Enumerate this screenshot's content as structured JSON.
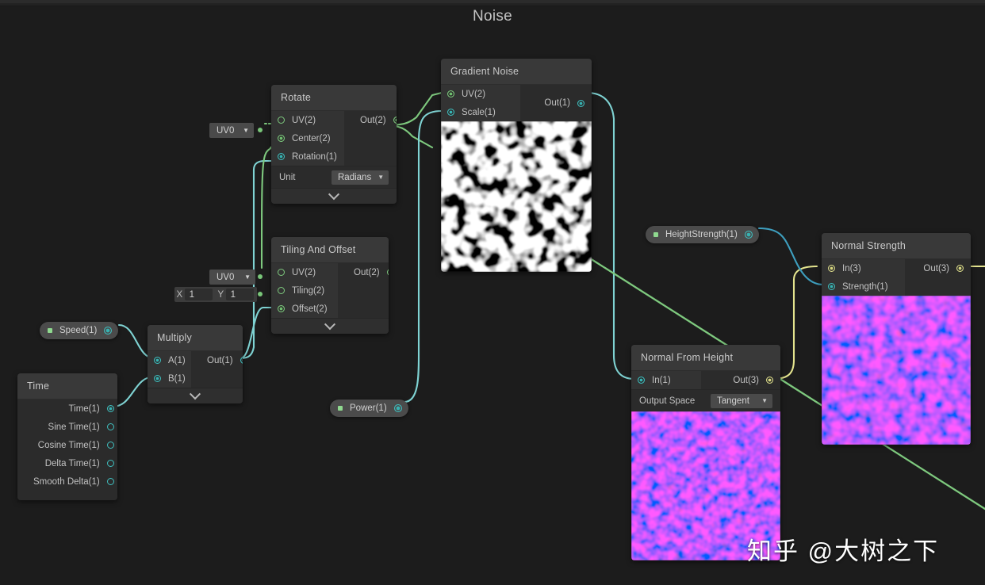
{
  "window": {
    "graph_title": "Noise"
  },
  "watermark": {
    "text": "知乎 @大树之下"
  },
  "nodes": {
    "rotate": {
      "title": "Rotate",
      "inputs": [
        {
          "label": "UV(2)",
          "type": "green",
          "connected": false
        },
        {
          "label": "Center(2)",
          "type": "green",
          "connected": true
        },
        {
          "label": "Rotation(1)",
          "type": "cyan",
          "connected": true
        }
      ],
      "outputs": [
        {
          "label": "Out(2)",
          "type": "green",
          "connected": true
        }
      ],
      "control": {
        "label": "Unit",
        "value": "Radians"
      }
    },
    "gradient_noise": {
      "title": "Gradient Noise",
      "inputs": [
        {
          "label": "UV(2)",
          "type": "green",
          "connected": true
        },
        {
          "label": "Scale(1)",
          "type": "cyan",
          "connected": true
        }
      ],
      "outputs": [
        {
          "label": "Out(1)",
          "type": "cyan",
          "connected": true
        }
      ],
      "preview": "grayscale-noise"
    },
    "tiling_and_offset": {
      "title": "Tiling And Offset",
      "inputs": [
        {
          "label": "UV(2)",
          "type": "green",
          "connected": false
        },
        {
          "label": "Tiling(2)",
          "type": "green",
          "connected": false
        },
        {
          "label": "Offset(2)",
          "type": "green",
          "connected": true
        }
      ],
      "outputs": [
        {
          "label": "Out(2)",
          "type": "green",
          "connected": false
        }
      ]
    },
    "multiply": {
      "title": "Multiply",
      "inputs": [
        {
          "label": "A(1)",
          "type": "cyan",
          "connected": true
        },
        {
          "label": "B(1)",
          "type": "cyan",
          "connected": true
        }
      ],
      "outputs": [
        {
          "label": "Out(1)",
          "type": "cyan",
          "connected": true
        }
      ]
    },
    "time": {
      "title": "Time",
      "outputs": [
        {
          "label": "Time(1)",
          "type": "cyan",
          "connected": true
        },
        {
          "label": "Sine Time(1)",
          "type": "cyan",
          "connected": false
        },
        {
          "label": "Cosine Time(1)",
          "type": "cyan",
          "connected": false
        },
        {
          "label": "Delta Time(1)",
          "type": "cyan",
          "connected": false
        },
        {
          "label": "Smooth Delta(1)",
          "type": "cyan",
          "connected": false
        }
      ]
    },
    "normal_from_height": {
      "title": "Normal From Height",
      "inputs": [
        {
          "label": "In(1)",
          "type": "cyan",
          "connected": true
        }
      ],
      "outputs": [
        {
          "label": "Out(3)",
          "type": "yellow",
          "connected": true
        }
      ],
      "control": {
        "label": "Output Space",
        "value": "Tangent"
      },
      "preview": "normal-map"
    },
    "normal_strength": {
      "title": "Normal Strength",
      "inputs": [
        {
          "label": "In(3)",
          "type": "yellow",
          "connected": true
        },
        {
          "label": "Strength(1)",
          "type": "cyan",
          "connected": true
        }
      ],
      "outputs": [
        {
          "label": "Out(3)",
          "type": "yellow",
          "connected": true
        }
      ],
      "preview": "normal-map"
    }
  },
  "properties": [
    {
      "name": "speed",
      "label": "Speed(1)",
      "type": "cyan"
    },
    {
      "name": "power",
      "label": "Power(1)",
      "type": "cyan"
    },
    {
      "name": "height_strength",
      "label": "HeightStrength(1)",
      "type": "cyan"
    }
  ],
  "widgets": {
    "uv_rotate": {
      "value": "UV0"
    },
    "uv_tiling": {
      "value": "UV0"
    },
    "tiling_vector": {
      "x_label": "X",
      "x_value": "1",
      "y_label": "Y",
      "y_value": "1"
    }
  },
  "colors": {
    "background": "#1c1c1c",
    "node_body": "#2b2b2b",
    "node_header": "#393939",
    "edge_green": "#7ec97e",
    "edge_cyan": "#7fd3d3",
    "edge_yellow": "#e5e58f",
    "port_green": "#7ec97e",
    "port_cyan": "#3fbfbf",
    "port_yellow": "#dcdc8c"
  }
}
